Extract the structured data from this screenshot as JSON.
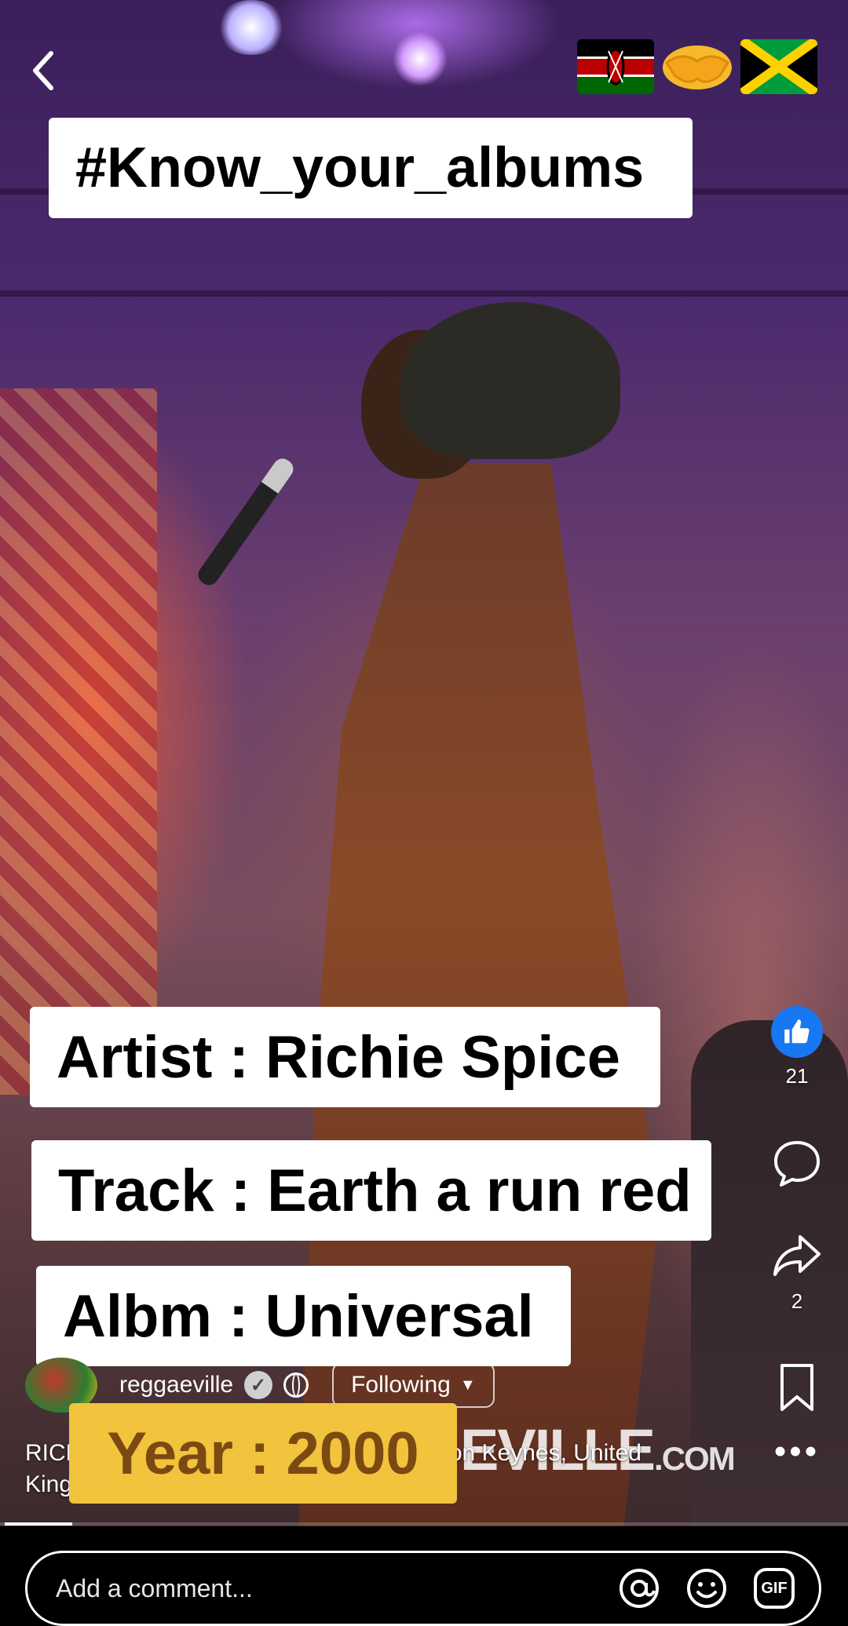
{
  "overlay": {
    "hashtag": "#Know_your_albums",
    "artist_line": "Artist : Richie Spice",
    "track_line": "Track : Earth a run red",
    "album_line": "Albm : Universal",
    "year_line": "Year : 2000"
  },
  "header": {
    "back_icon": "chevron-left-icon",
    "flags": [
      "kenya-flag",
      "handshake-emoji",
      "jamaica-flag"
    ]
  },
  "actions": {
    "like_count": "21",
    "share_count": "2"
  },
  "account": {
    "name": "reggaeville",
    "follow_label": "Following"
  },
  "caption": {
    "line1_start": "RICH",
    "line1_end": "ton Keynes, United",
    "line2": "King"
  },
  "watermark": {
    "main": "EVILLE",
    "suffix": ".COM"
  },
  "progress": {
    "fraction": 0.08
  },
  "comment_bar": {
    "placeholder": "Add a comment...",
    "gif_label": "GIF"
  },
  "colors": {
    "like_blue": "#1877f2",
    "year_yellow": "#f2c33c",
    "year_text": "#7a4a12"
  }
}
